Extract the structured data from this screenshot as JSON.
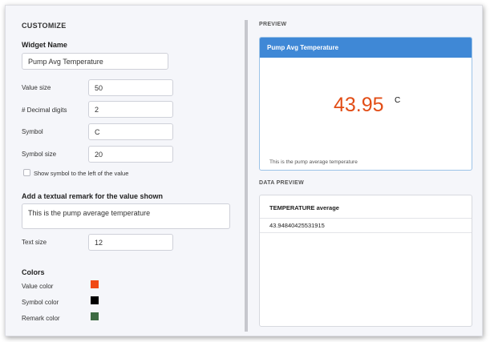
{
  "customize": {
    "title": "CUSTOMIZE",
    "widget_name_label": "Widget Name",
    "widget_name_value": "Pump Avg Temperature",
    "fields": [
      {
        "label": "Value size",
        "value": "50"
      },
      {
        "label": "# Decimal digits",
        "value": "2"
      },
      {
        "label": "Symbol",
        "value": "C"
      },
      {
        "label": "Symbol size",
        "value": "20"
      }
    ],
    "show_symbol_left_label": "Show symbol to the left of the value",
    "show_symbol_left_checked": false,
    "remark_label": "Add a textual remark for the value shown",
    "remark_value": "This is the pump average temperature",
    "text_size_label": "Text size",
    "text_size_value": "12",
    "colors_label": "Colors",
    "colors": [
      {
        "label": "Value color",
        "hex": "#f04a14"
      },
      {
        "label": "Symbol color",
        "hex": "#000000"
      },
      {
        "label": "Remark color",
        "hex": "#3e6b42"
      }
    ]
  },
  "preview": {
    "title": "PREVIEW",
    "widget_header": "Pump Avg Temperature",
    "value": "43.95",
    "symbol": "C",
    "remark": "This is the pump average temperature",
    "header_color": "#3f88d6",
    "value_color": "#e24d16"
  },
  "data_preview": {
    "title": "DATA PREVIEW",
    "column": "TEMPERATURE average",
    "rows": [
      "43.94840425531915"
    ]
  }
}
